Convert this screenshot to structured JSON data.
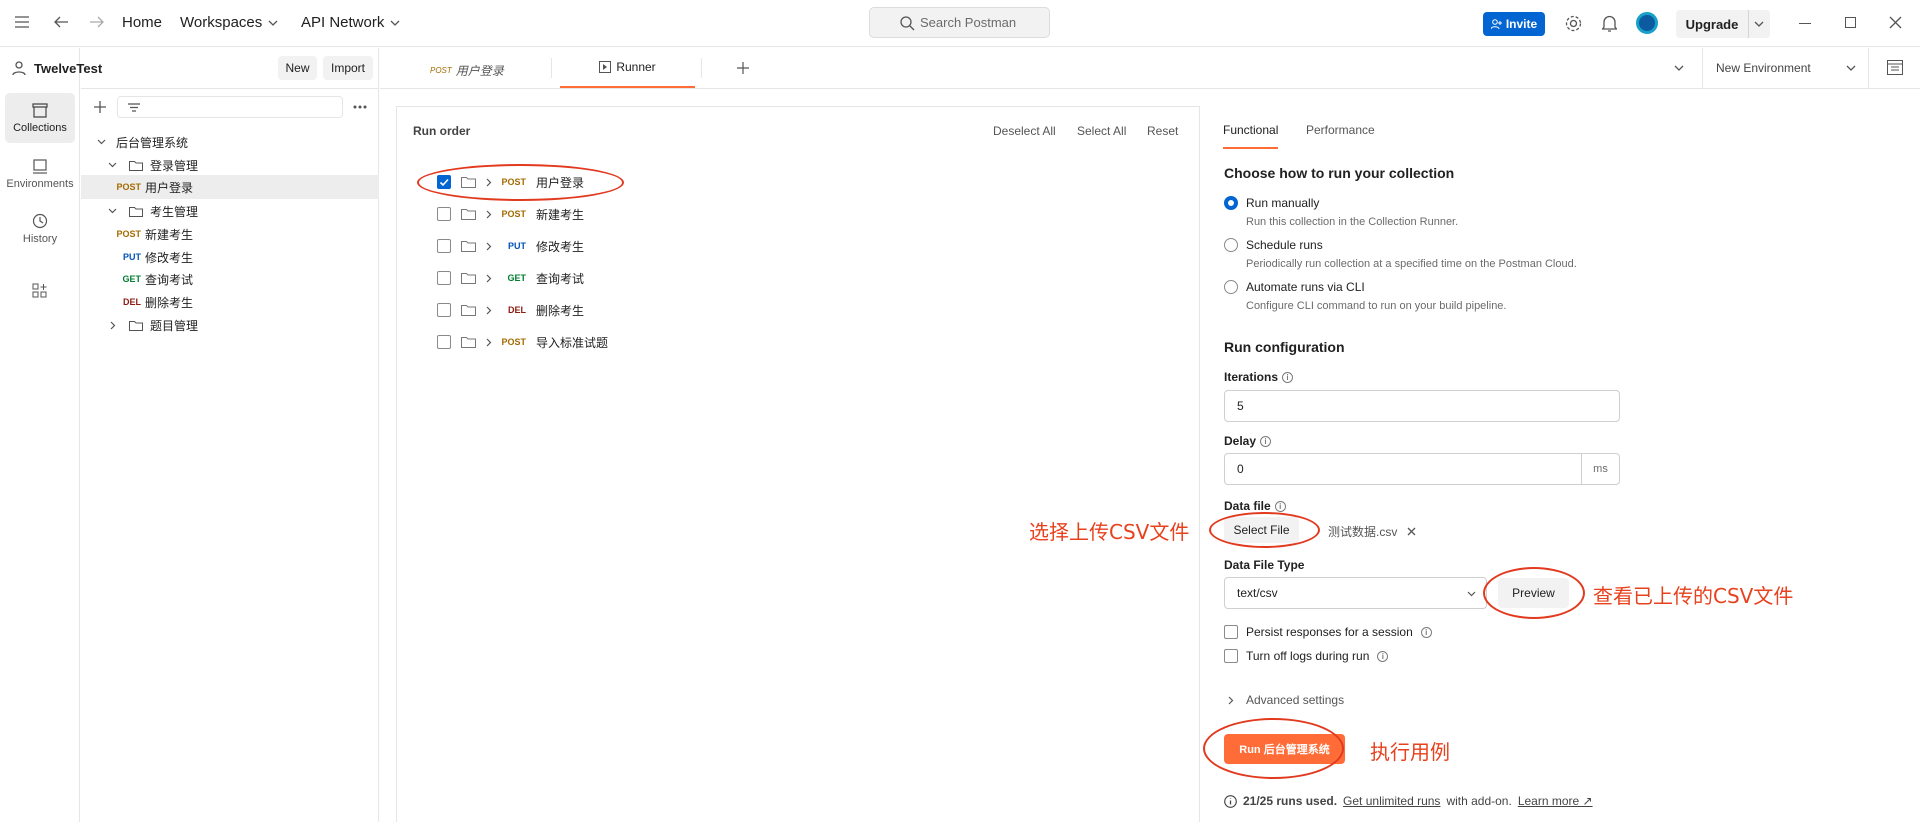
{
  "topbar": {
    "home": "Home",
    "workspaces": "Workspaces",
    "api_network": "API Network",
    "search_placeholder": "Search Postman",
    "invite": "Invite",
    "upgrade": "Upgrade"
  },
  "workspace": {
    "name": "TwelveTest",
    "new_label": "New",
    "import_label": "Import"
  },
  "rail": [
    {
      "label": "Collections",
      "icon": "collections-icon"
    },
    {
      "label": "Environments",
      "icon": "environments-icon"
    },
    {
      "label": "History",
      "icon": "history-icon"
    }
  ],
  "tree": {
    "collection": "后台管理系统",
    "folder1": "登录管理",
    "req1": {
      "method": "POST",
      "name": "用户登录"
    },
    "folder2": "考生管理",
    "req2": {
      "method": "POST",
      "name": "新建考生"
    },
    "req3": {
      "method": "PUT",
      "name": "修改考生"
    },
    "req4": {
      "method": "GET",
      "name": "查询考试"
    },
    "req5": {
      "method": "DEL",
      "name": "删除考生"
    },
    "folder3": "题目管理"
  },
  "tabs": {
    "tab1_method": "POST",
    "tab1_name": "用户登录",
    "tab2": "Runner",
    "env": "New Environment"
  },
  "run_order": {
    "title": "Run order",
    "deselect": "Deselect All",
    "select": "Select All",
    "reset": "Reset",
    "items": [
      {
        "method": "POST",
        "name": "用户登录",
        "checked": true
      },
      {
        "method": "POST",
        "name": "新建考生",
        "checked": false
      },
      {
        "method": "PUT",
        "name": "修改考生",
        "checked": false
      },
      {
        "method": "GET",
        "name": "查询考试",
        "checked": false
      },
      {
        "method": "DEL",
        "name": "删除考生",
        "checked": false
      },
      {
        "method": "POST",
        "name": "导入标准试题",
        "checked": false
      }
    ]
  },
  "config": {
    "tab_functional": "Functional",
    "tab_performance": "Performance",
    "how_title": "Choose how to run your collection",
    "opt1": "Run manually",
    "opt1_desc": "Run this collection in the Collection Runner.",
    "opt2": "Schedule runs",
    "opt2_desc": "Periodically run collection at a specified time on the Postman Cloud.",
    "opt3": "Automate runs via CLI",
    "opt3_desc": "Configure CLI command to run on your build pipeline.",
    "run_config_title": "Run configuration",
    "iterations_label": "Iterations",
    "iterations": "5",
    "delay_label": "Delay",
    "delay": "0",
    "delay_unit": "ms",
    "data_file_label": "Data file",
    "select_file": "Select File",
    "file_name": "测试数据.csv",
    "data_file_type_label": "Data File Type",
    "data_file_type": "text/csv",
    "preview": "Preview",
    "persist": "Persist responses for a session",
    "turn_off_logs": "Turn off logs during run",
    "advanced": "Advanced settings",
    "run_button": "Run 后台管理系统",
    "runs_used": "21/25 runs used.",
    "get_unlimited": "Get unlimited runs",
    "with_addon": "with add-on.",
    "learn_more": "Learn more ↗"
  },
  "annotations": {
    "select_csv": "选择上传CSV文件",
    "view_csv": "查看已上传的CSV文件",
    "run_cases": "执行用例"
  },
  "colors": {
    "accent": "#0265d2",
    "run_button": "#ff6c37",
    "annotation": "#e8411d",
    "post": "#a36a00",
    "put": "#0053b8",
    "get": "#007f31",
    "del": "#8e1a10"
  }
}
